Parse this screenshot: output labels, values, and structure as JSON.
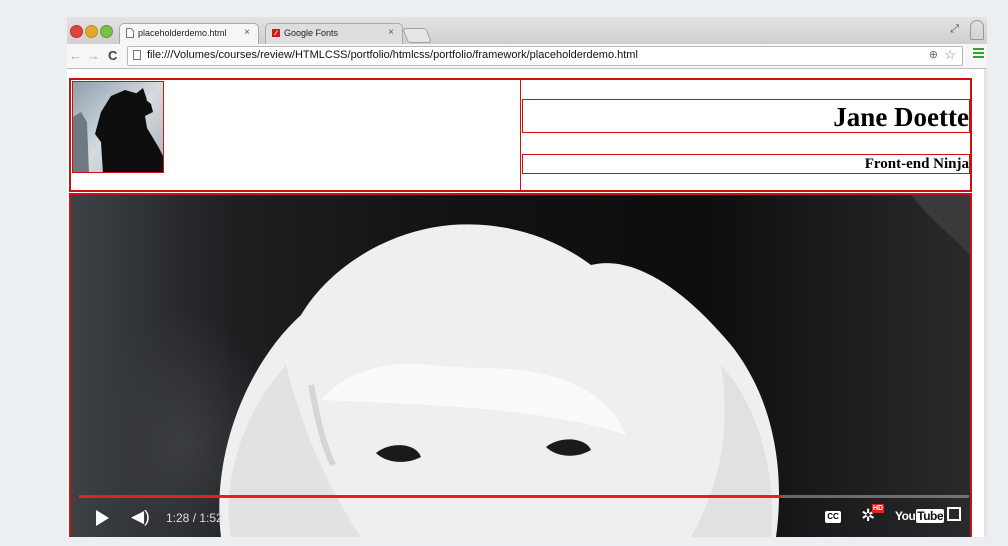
{
  "browser": {
    "tabs": [
      {
        "title": "placeholderdemo.html",
        "active": true,
        "close": "×"
      },
      {
        "title": "Google Fonts",
        "active": false,
        "close": "×"
      }
    ],
    "url": "file:///Volumes/courses/review/HTMLCSS/portfolio/htmlcss/portfolio/framework/placeholderdemo.html"
  },
  "page": {
    "name": "Jane Doette",
    "role": "Front-end Ninja"
  },
  "video": {
    "current_time": "1:28",
    "duration": "1:52",
    "time_display": "1:28 / 1:52",
    "progress": 0.79,
    "cc_label": "CC",
    "hd_badge": "HD",
    "youtube_logo": "You",
    "youtube_logo_tube": "Tube"
  },
  "icons": {
    "back": "arrow-left-icon",
    "forward": "arrow-right-icon",
    "reload": "reload-icon",
    "zoom": "magnifier-icon",
    "bookmark": "star-icon",
    "menu": "hamburger-menu-icon"
  },
  "colors": {
    "outline": "#cc1111",
    "progress": "#e62117",
    "menu_icon": "#3a9b3a"
  }
}
